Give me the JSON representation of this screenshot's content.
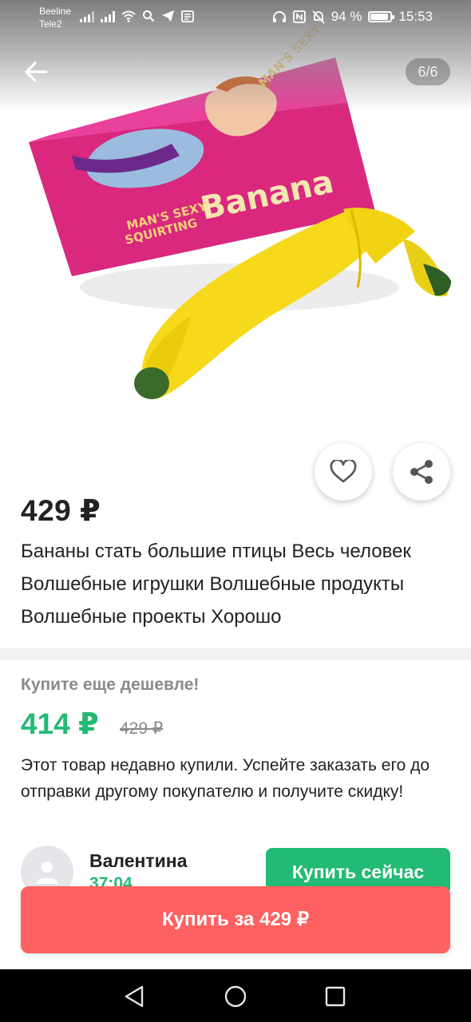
{
  "status_bar": {
    "carrier1": "Beeline",
    "carrier2": "Tele2",
    "battery": "94 %",
    "time": "15:53"
  },
  "gallery": {
    "counter": "6/6",
    "box_text_1": "MAN'S SEXY",
    "box_text_2": "SQUIRTING",
    "box_text_3": "Banana"
  },
  "product": {
    "price": "429 ₽",
    "title": "Бананы стать большие птицы Весь человек Волшебные игрушки Волшебные продукты Волшебные проекты Хорошо"
  },
  "offer": {
    "label": "Купите еще дешевле!",
    "new_price": "414 ₽",
    "old_price": "429 ₽",
    "description": "Этот товар недавно купили. Успейте заказать его до отправки другому покупателю и получите скидку!",
    "buyer_name": "Валентина",
    "buyer_time": "37:04",
    "buy_now_label": "Купить сейчас"
  },
  "main_button": {
    "label": "Купить за 429 ₽"
  },
  "colors": {
    "accent_green": "#23ba75",
    "buy_red": "#ff6161"
  }
}
